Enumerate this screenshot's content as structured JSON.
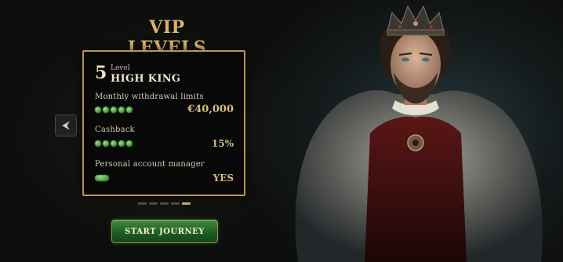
{
  "title": "VIP LEVELS",
  "level": {
    "label": "Level",
    "number": "5",
    "name": "HIGH KING"
  },
  "benefits": [
    {
      "label": "Monthly withdrawal limits",
      "value": "€40,000",
      "dots": 5
    },
    {
      "label": "Cashback",
      "value": "15%",
      "dots": 5
    },
    {
      "label": "Personal account manager",
      "value": "YES",
      "dots": 1
    }
  ],
  "pager": {
    "total": 5,
    "active_index": 4
  },
  "cta": {
    "label": "START JOURNEY"
  },
  "icons": {
    "prev": "chevron-left-icon"
  },
  "colors": {
    "gold": "#d7b36a",
    "accent_green": "#3e8f35",
    "card_border": "#b89556"
  }
}
